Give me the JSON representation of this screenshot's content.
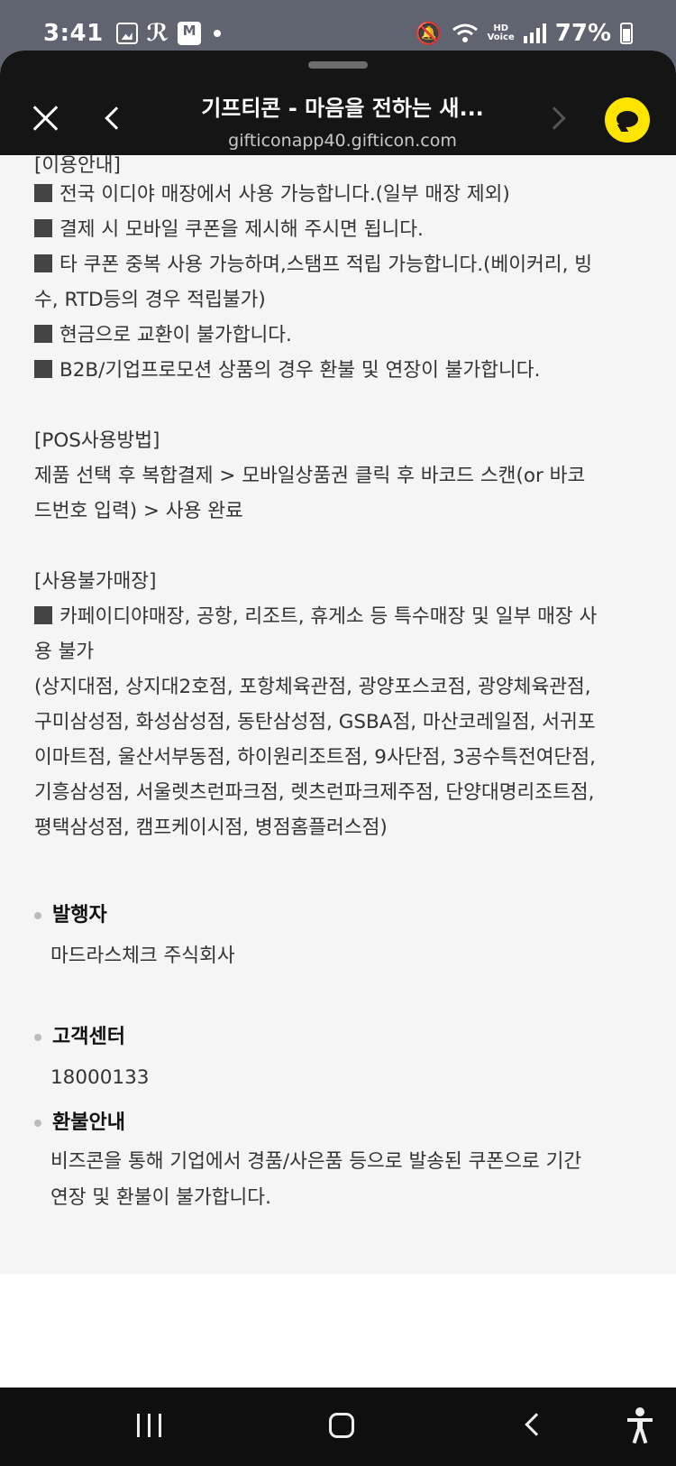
{
  "status_bar": {
    "time": "3:41",
    "icons": [
      "gallery-icon",
      "runner-icon",
      "mstock-icon",
      "dot-icon"
    ],
    "right_icons": [
      "mute-icon",
      "wifi-icon",
      "hd-voice-icon",
      "signal-icon",
      "battery-icon"
    ],
    "mstock_label": "M",
    "hd_label": "HD",
    "voice_label": "Voice",
    "battery_percent": "77%"
  },
  "toolbar": {
    "title": "기프티콘 - 마음을 전하는 새...",
    "url": "gifticonapp40.gifticon.com"
  },
  "content": {
    "cut_line": "[이용안내]",
    "usage_lines": [
      "전국 이디야 매장에서 사용 가능합니다.(일부 매장 제외)",
      "결제 시 모바일 쿠폰을 제시해 주시면 됩니다.",
      "타 쿠폰 중복 사용 가능하며,스탬프 적립 가능합니다.(베이커리, 빙",
      "수, RTD등의 경우 적립불가)",
      "현금으로 교환이 불가합니다.",
      "B2B/기업프로모션 상품의 경우 환불 및 연장이 불가합니다."
    ],
    "pos_heading": "[POS사용방법]",
    "pos_lines": [
      "제품 선택 후 복합결제 > 모바일상품권 클릭 후 바코드 스캔(or 바코",
      "드번호 입력) > 사용 완료"
    ],
    "restricted_heading": "[사용불가매장]",
    "restricted_lines": [
      "카페이디야매장, 공항, 리조트, 휴게소 등 특수매장 및 일부 매장 사",
      "용 불가",
      "(상지대점, 상지대2호점, 포항체육관점, 광양포스코점, 광양체육관점,",
      "구미삼성점, 화성삼성점, 동탄삼성점, GSBA점, 마산코레일점, 서귀포",
      "이마트점, 울산서부동점, 하이원리조트점, 9사단점, 3공수특전여단점,",
      "기흥삼성점, 서울렛츠런파크점, 렛츠런파크제주점, 단양대명리조트점,",
      "평택삼성점, 캠프케이시점, 병점홈플러스점)"
    ]
  },
  "info": {
    "issuer_label": "발행자",
    "issuer_value": "마드라스체크 주식회사",
    "customer_center_label": "고객센터",
    "customer_center_value": "18000133",
    "refund_label": "환불안내",
    "refund_lines": [
      "비즈콘을 통해 기업에서 경품/사은품 등으로 발송된 쿠폰으로 기간",
      "연장 및 환불이 불가합니다."
    ]
  },
  "nav_bar": {
    "buttons": [
      "recent-apps-icon",
      "home-icon",
      "back-icon",
      "accessibility-icon"
    ]
  }
}
